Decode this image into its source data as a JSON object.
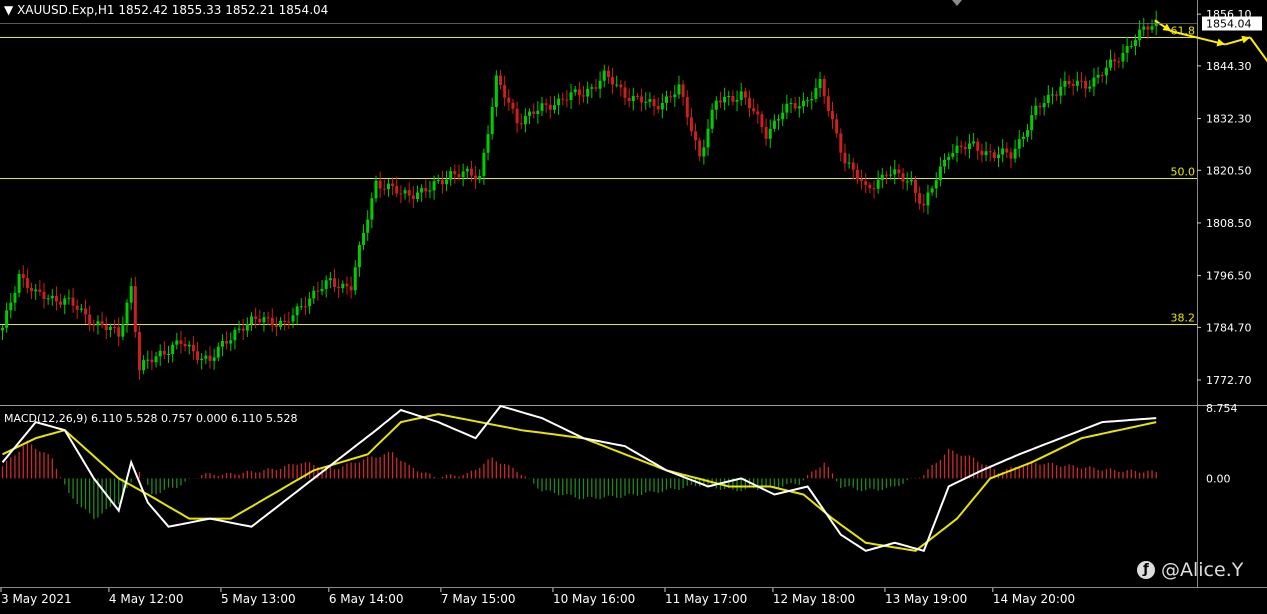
{
  "header": {
    "symbol": "XAUUSD.Exp,H1",
    "ohlc": "1852.42 1855.33 1852.21 1854.04"
  },
  "macd_header": "MACD(12,26,9) 6.110 5.528 0.757 0.000 6.110 5.528",
  "watermark": "@Alice.Y",
  "colors": {
    "background": "#000000",
    "bull_candle": "#00cc00",
    "bear_candle": "#cc1f1f",
    "fib_line": "#e8e800",
    "price_tag_bg": "#ffffff",
    "macd_line": "#ffffff",
    "signal_line": "#e6e600",
    "hist_pos": "#cc2a2a",
    "hist_neg": "#1f8a1f",
    "axis_text": "#ffffff",
    "arrow": "#ffee00"
  },
  "icons": {
    "dropdown": "triangle-down-icon",
    "watermark_logo": "social-logo-icon"
  },
  "chart_data": [
    {
      "type": "candlestick",
      "title": "XAUUSD.Exp,H1",
      "ylim": [
        1767.0,
        1857.5
      ],
      "y_ticks": [
        "1856.10",
        "1844.30",
        "1832.30",
        "1820.50",
        "1808.50",
        "1796.50",
        "1784.70",
        "1772.70"
      ],
      "x_ticks": [
        "3 May 2021",
        "4 May 12:00",
        "5 May 13:00",
        "6 May 14:00",
        "7 May 15:00",
        "10 May 16:00",
        "11 May 17:00",
        "12 May 18:00",
        "13 May 19:00",
        "14 May 20:00"
      ],
      "current_price": "1854.04",
      "fib_levels": [
        {
          "label": "61.8",
          "value": 1851.0
        },
        {
          "label": "50.0",
          "value": 1818.7
        },
        {
          "label": "38.2",
          "value": 1785.5
        }
      ],
      "price_path": [
        [
          0,
          1784
        ],
        [
          4,
          1797
        ],
        [
          8,
          1792
        ],
        [
          15,
          1791
        ],
        [
          22,
          1786
        ],
        [
          28,
          1783
        ],
        [
          31,
          1794
        ],
        [
          33,
          1775
        ],
        [
          38,
          1779
        ],
        [
          43,
          1781
        ],
        [
          50,
          1777
        ],
        [
          56,
          1784
        ],
        [
          63,
          1787
        ],
        [
          68,
          1785
        ],
        [
          73,
          1791
        ],
        [
          79,
          1795
        ],
        [
          84,
          1794
        ],
        [
          90,
          1818
        ],
        [
          96,
          1815
        ],
        [
          103,
          1816
        ],
        [
          108,
          1820
        ],
        [
          115,
          1819
        ],
        [
          119,
          1841
        ],
        [
          124,
          1832
        ],
        [
          129,
          1834
        ],
        [
          135,
          1837
        ],
        [
          140,
          1838
        ],
        [
          145,
          1842
        ],
        [
          150,
          1838
        ],
        [
          157,
          1835
        ],
        [
          163,
          1839
        ],
        [
          168,
          1824
        ],
        [
          172,
          1836
        ],
        [
          178,
          1838
        ],
        [
          184,
          1829
        ],
        [
          188,
          1834
        ],
        [
          193,
          1836
        ],
        [
          197,
          1840
        ],
        [
          203,
          1823
        ],
        [
          208,
          1816
        ],
        [
          213,
          1820
        ],
        [
          219,
          1818
        ],
        [
          222,
          1812
        ],
        [
          228,
          1825
        ],
        [
          234,
          1826
        ],
        [
          239,
          1824
        ],
        [
          243,
          1824
        ],
        [
          249,
          1834
        ],
        [
          255,
          1840
        ],
        [
          261,
          1840
        ],
        [
          268,
          1845
        ],
        [
          273,
          1851
        ],
        [
          278,
          1854
        ]
      ],
      "forecast_arrow": [
        [
          278,
          1854.7
        ],
        [
          282,
          1852.2
        ],
        [
          295,
          1849.2
        ],
        [
          301,
          1850.8
        ],
        [
          307,
          1843
        ]
      ]
    },
    {
      "type": "macd",
      "title": "MACD(12,26,9)",
      "ylim": [
        -13.5,
        8.754
      ],
      "y_ticks": [
        "8.754",
        "0.00"
      ],
      "macd_path": [
        [
          0,
          2
        ],
        [
          8,
          7
        ],
        [
          15,
          6
        ],
        [
          22,
          0
        ],
        [
          28,
          -4
        ],
        [
          31,
          2
        ],
        [
          35,
          -3
        ],
        [
          40,
          -6
        ],
        [
          50,
          -5
        ],
        [
          60,
          -6
        ],
        [
          70,
          -2
        ],
        [
          80,
          2
        ],
        [
          90,
          6
        ],
        [
          96,
          8.5
        ],
        [
          105,
          7
        ],
        [
          114,
          5
        ],
        [
          120,
          9
        ],
        [
          130,
          7.5
        ],
        [
          140,
          5
        ],
        [
          150,
          4
        ],
        [
          160,
          1
        ],
        [
          170,
          -1
        ],
        [
          178,
          0
        ],
        [
          186,
          -2
        ],
        [
          194,
          -1
        ],
        [
          202,
          -7
        ],
        [
          208,
          -9
        ],
        [
          215,
          -8
        ],
        [
          222,
          -9
        ],
        [
          228,
          -1
        ],
        [
          236,
          1
        ],
        [
          245,
          3
        ],
        [
          255,
          5
        ],
        [
          265,
          7
        ],
        [
          278,
          7.5
        ]
      ],
      "signal_path": [
        [
          0,
          3
        ],
        [
          8,
          5
        ],
        [
          15,
          6
        ],
        [
          28,
          0
        ],
        [
          35,
          -2
        ],
        [
          45,
          -5
        ],
        [
          55,
          -5
        ],
        [
          65,
          -2
        ],
        [
          75,
          1
        ],
        [
          88,
          3
        ],
        [
          96,
          7
        ],
        [
          105,
          8
        ],
        [
          115,
          7
        ],
        [
          125,
          6
        ],
        [
          140,
          5
        ],
        [
          160,
          1
        ],
        [
          175,
          -1
        ],
        [
          185,
          -1
        ],
        [
          193,
          -2
        ],
        [
          200,
          -5
        ],
        [
          208,
          -8
        ],
        [
          220,
          -9
        ],
        [
          230,
          -5
        ],
        [
          238,
          0
        ],
        [
          248,
          2
        ],
        [
          260,
          5
        ],
        [
          278,
          7
        ]
      ],
      "histogram": [
        [
          0,
          1.5
        ],
        [
          6,
          4.5
        ],
        [
          12,
          2.5
        ],
        [
          16,
          -2
        ],
        [
          22,
          -5
        ],
        [
          28,
          -3
        ],
        [
          33,
          1
        ],
        [
          36,
          -2
        ],
        [
          42,
          -1
        ],
        [
          48,
          0.5
        ],
        [
          54,
          0.5
        ],
        [
          60,
          0.8
        ],
        [
          66,
          1.2
        ],
        [
          72,
          2
        ],
        [
          80,
          1.2
        ],
        [
          88,
          2.5
        ],
        [
          94,
          3.2
        ],
        [
          98,
          1.5
        ],
        [
          104,
          0.2
        ],
        [
          112,
          0.5
        ],
        [
          118,
          2.5
        ],
        [
          124,
          1
        ],
        [
          130,
          -1.5
        ],
        [
          140,
          -2.5
        ],
        [
          150,
          -2.2
        ],
        [
          160,
          -1.5
        ],
        [
          168,
          -0.8
        ],
        [
          176,
          -1.5
        ],
        [
          184,
          -1.2
        ],
        [
          192,
          -0.6
        ],
        [
          198,
          2
        ],
        [
          202,
          -1
        ],
        [
          208,
          -1.5
        ],
        [
          214,
          -1.2
        ],
        [
          222,
          0.5
        ],
        [
          228,
          3.5
        ],
        [
          234,
          2.5
        ],
        [
          240,
          0.8
        ],
        [
          248,
          2
        ],
        [
          258,
          1.5
        ],
        [
          268,
          1
        ],
        [
          278,
          0.8
        ]
      ]
    }
  ]
}
